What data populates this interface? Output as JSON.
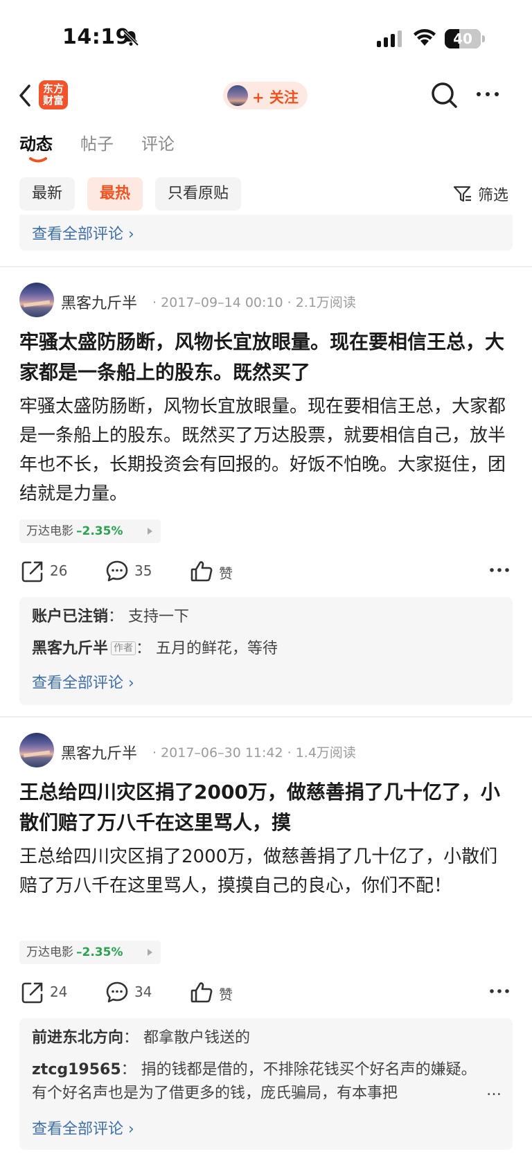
{
  "status_bar": {
    "time": "14:19",
    "battery": "40",
    "battery_level": 0.4
  },
  "nav": {
    "logo_text": "东方\n财富",
    "follow_label": "+ 关注"
  },
  "tabs": [
    {
      "label": "动态",
      "active": true
    },
    {
      "label": "帖子",
      "active": false
    },
    {
      "label": "评论",
      "active": false
    }
  ],
  "filters": {
    "options": [
      {
        "label": "最新",
        "active": false
      },
      {
        "label": "最热",
        "active": true
      },
      {
        "label": "只看原贴",
        "active": false
      }
    ],
    "filter_label": "筛选"
  },
  "top_comments": {
    "view_all": "查看全部评论 ›"
  },
  "posts": [
    {
      "author": "黑客九斤半",
      "meta": "· 2017–09–14 00:10 · 2.1万阅读",
      "title": "牢骚太盛防肠断，风物长宜放眼量。现在要相信王总，大家都是一条船上的股东。既然买了",
      "body": "牢骚太盛防肠断，风物长宜放眼量。现在要相信王总，大家都是一条船上的股东。既然买了万达股票，就要相信自己，放半年也不长，长期投资会有回报的。好饭不怕晚。大家挺住，团结就是力量。",
      "stock": {
        "name": "万达电影",
        "change": "–2.35%"
      },
      "shares": "26",
      "comments_count": "35",
      "like_label": "赞",
      "comments": [
        {
          "user": "账户已注销",
          "text": "：  支持一下"
        },
        {
          "user": "黑客九斤半",
          "badge": "作者",
          "text": "：  五月的鲜花，等待"
        }
      ],
      "view_all": "查看全部评论 ›"
    },
    {
      "author": "黑客九斤半",
      "meta": "· 2017–06–30 11:42 · 1.4万阅读",
      "title": "王总给四川灾区捐了2000万，做慈善捐了几十亿了，小散们赔了万八千在这里骂人，摸",
      "body": "王总给四川灾区捐了2000万，做慈善捐了几十亿了，小散们赔了万八千在这里骂人，摸摸自己的良心，你们不配！",
      "stock": {
        "name": "万达电影",
        "change": "–2.35%"
      },
      "shares": "24",
      "comments_count": "34",
      "like_label": "赞",
      "comments": [
        {
          "user": "前进东北方向",
          "text": "：  都拿散户钱送的"
        },
        {
          "user": "ztcg19565",
          "text": "：  捐的钱都是借的，不排除花钱买个好名声的嫌疑。有个好名声也是为了借更多的钱，庞氏骗局，有本事把"
        }
      ],
      "ellipsis": "…",
      "view_all": "查看全部评论 ›"
    }
  ],
  "colors": {
    "accent": "#f0531f",
    "link": "#3f6fa8",
    "stock_down": "#2aa150"
  },
  "icons": [
    "bell-slash-icon",
    "signal-icon",
    "wifi-icon",
    "battery-icon",
    "back-icon",
    "search-icon",
    "more-icon",
    "filter-icon",
    "share-icon",
    "comment-icon",
    "like-icon"
  ]
}
